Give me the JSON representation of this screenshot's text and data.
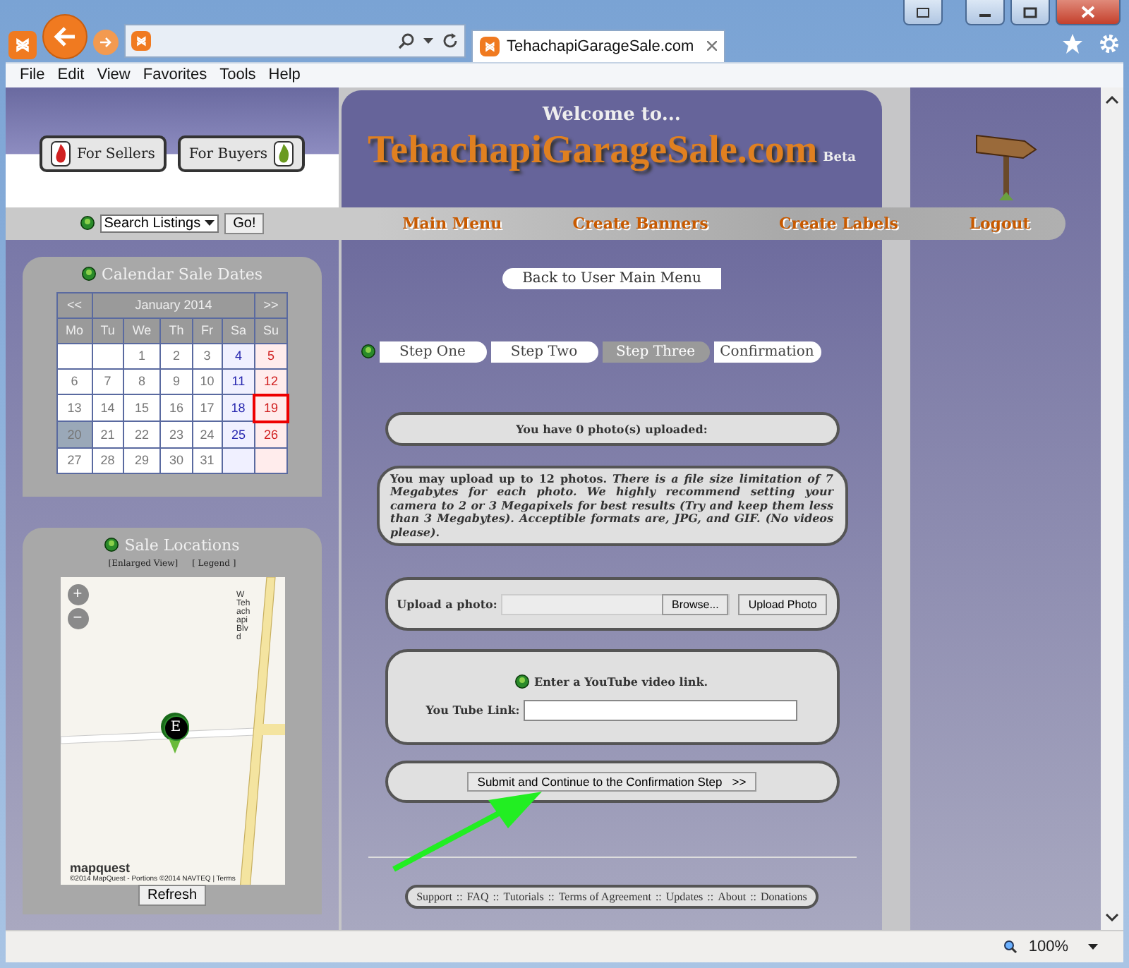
{
  "browser": {
    "tab_title": "TehachapiGarageSale.com",
    "menu": [
      "File",
      "Edit",
      "View",
      "Favorites",
      "Tools",
      "Help"
    ],
    "zoom": "100%"
  },
  "header": {
    "sellers": "For Sellers",
    "buyers": "For Buyers",
    "welcome": "Welcome to...",
    "site": "TehachapiGarageSale.com",
    "beta": "Beta"
  },
  "search": {
    "value": "Search Listings",
    "go": "Go!"
  },
  "nav": [
    "Main Menu",
    "Create Banners",
    "Create Labels",
    "Logout"
  ],
  "calendar": {
    "title": "Calendar Sale Dates",
    "prev": "<<",
    "month": "January 2014",
    "next": ">>",
    "weekdays": [
      "Mo",
      "Tu",
      "We",
      "Th",
      "Fr",
      "Sa",
      "Su"
    ],
    "weeks": [
      [
        {
          "kind": "plain",
          "today": false,
          "selected": false
        },
        {
          "kind": "plain",
          "today": false,
          "selected": false
        },
        {
          "day": "1",
          "kind": "plain",
          "today": false,
          "selected": false
        },
        {
          "day": "2",
          "kind": "plain",
          "today": false,
          "selected": false
        },
        {
          "day": "3",
          "kind": "plain",
          "today": false,
          "selected": false
        },
        {
          "day": "4",
          "kind": "sat",
          "today": false,
          "selected": false
        },
        {
          "day": "5",
          "kind": "sun",
          "today": false,
          "selected": false
        }
      ],
      [
        {
          "day": "6",
          "kind": "plain",
          "today": false,
          "selected": false
        },
        {
          "day": "7",
          "kind": "plain",
          "today": false,
          "selected": false
        },
        {
          "day": "8",
          "kind": "plain",
          "today": false,
          "selected": false
        },
        {
          "day": "9",
          "kind": "plain",
          "today": false,
          "selected": false
        },
        {
          "day": "10",
          "kind": "plain",
          "today": false,
          "selected": false
        },
        {
          "day": "11",
          "kind": "sat",
          "today": false,
          "selected": false
        },
        {
          "day": "12",
          "kind": "sun",
          "today": false,
          "selected": false
        }
      ],
      [
        {
          "day": "13",
          "kind": "plain",
          "today": false,
          "selected": false
        },
        {
          "day": "14",
          "kind": "plain",
          "today": false,
          "selected": false
        },
        {
          "day": "15",
          "kind": "plain",
          "today": false,
          "selected": false
        },
        {
          "day": "16",
          "kind": "plain",
          "today": false,
          "selected": false
        },
        {
          "day": "17",
          "kind": "plain",
          "today": false,
          "selected": false
        },
        {
          "day": "18",
          "kind": "sat",
          "today": false,
          "selected": false
        },
        {
          "day": "19",
          "kind": "sun",
          "today": true,
          "selected": false
        }
      ],
      [
        {
          "day": "20",
          "kind": "plain",
          "today": false,
          "selected": true
        },
        {
          "day": "21",
          "kind": "plain",
          "today": false,
          "selected": false
        },
        {
          "day": "22",
          "kind": "plain",
          "today": false,
          "selected": false
        },
        {
          "day": "23",
          "kind": "plain",
          "today": false,
          "selected": false
        },
        {
          "day": "24",
          "kind": "plain",
          "today": false,
          "selected": false
        },
        {
          "day": "25",
          "kind": "sat",
          "today": false,
          "selected": false
        },
        {
          "day": "26",
          "kind": "sun",
          "today": false,
          "selected": false
        }
      ],
      [
        {
          "day": "27",
          "kind": "plain",
          "today": false,
          "selected": false
        },
        {
          "day": "28",
          "kind": "plain",
          "today": false,
          "selected": false
        },
        {
          "day": "29",
          "kind": "plain",
          "today": false,
          "selected": false
        },
        {
          "day": "30",
          "kind": "plain",
          "today": false,
          "selected": false
        },
        {
          "day": "31",
          "kind": "plain",
          "today": false,
          "selected": false
        },
        {
          "kind": "sat",
          "today": false,
          "selected": false
        },
        {
          "kind": "sun",
          "today": false,
          "selected": false
        }
      ]
    ]
  },
  "locations": {
    "title": "Sale Locations",
    "enlarged": "[Enlarged View]",
    "legend": "[ Legend ]",
    "road": "W Tehachapi Blvd",
    "marker": "E",
    "zoom_in": "+",
    "zoom_out": "−",
    "brand": "mapquest",
    "credit": "©2014 MapQuest - Portions ©2014 NAVTEQ | Terms",
    "refresh": "Refresh"
  },
  "back": "Back to User Main Menu",
  "steps": [
    {
      "label": "Step One",
      "selected": false
    },
    {
      "label": "Step Two",
      "selected": false
    },
    {
      "label": "Step Three",
      "selected": true
    },
    {
      "label": "Confirmation",
      "selected": false
    }
  ],
  "uploaded": "You have 0 photo(s) uploaded:",
  "info": "You may upload up to 12 photos. *There is a file size limitation of 7 Megabytes for each photo. We highly recommend setting your camera to 2 or 3 Megapixels for best results (Try and keep them less than 3 Megabytes). Acceptible formats are, JPG, and GIF. (No videos please).*",
  "upload": {
    "label": "Upload a photo:",
    "browse": "Browse...",
    "button": "Upload Photo"
  },
  "youtube": {
    "hint": "Enter a YouTube video link.",
    "label": "You Tube Link:"
  },
  "submit": "Submit and Continue to the Confirmation Step   >>",
  "footer": [
    "Support",
    "FAQ",
    "Tutorials",
    "Terms of Agreement",
    "Updates",
    "About",
    "Donations"
  ],
  "footer_sep": "::"
}
